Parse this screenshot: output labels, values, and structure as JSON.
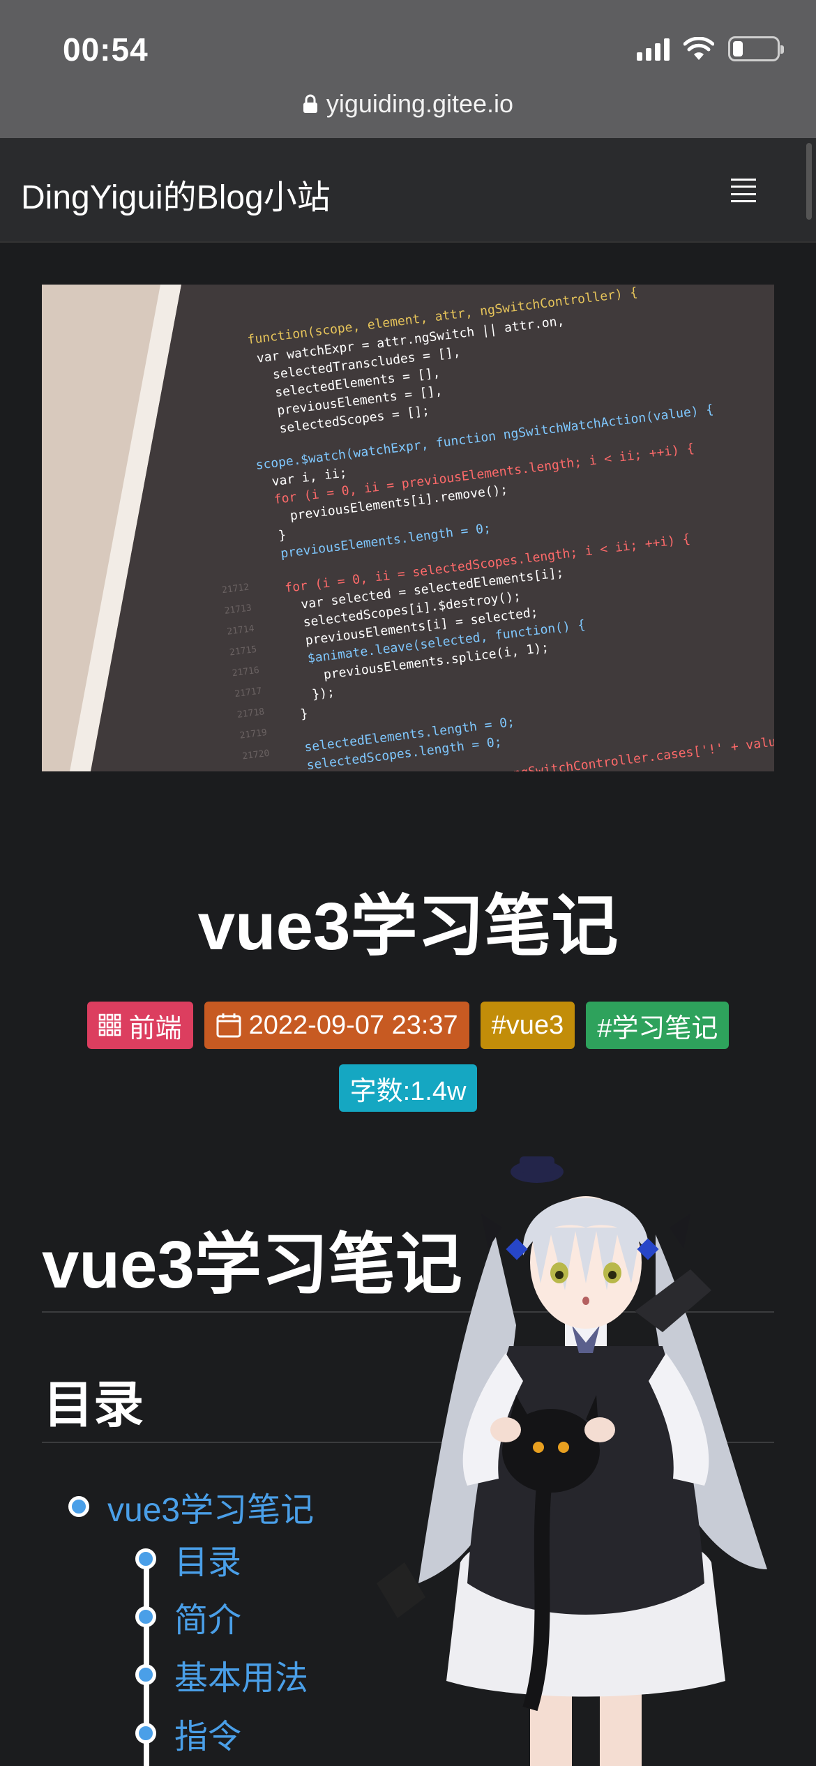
{
  "status_bar": {
    "time": "00:54",
    "url": "yiguiding.gitee.io"
  },
  "navbar": {
    "brand": "DingYigui的Blog小站"
  },
  "post": {
    "title": "vue3学习笔记",
    "badges": {
      "category": "前端",
      "date": "2022-09-07 23:37",
      "tag1": "#vue3",
      "tag2": "#学习笔记",
      "words": "字数:1.4w"
    }
  },
  "article": {
    "h1": "vue3学习笔记",
    "h2": "目录",
    "toc": [
      {
        "label": "vue3学习笔记"
      },
      {
        "label": "目录"
      },
      {
        "label": "简介"
      },
      {
        "label": "基本用法"
      },
      {
        "label": "指令"
      }
    ]
  },
  "colors": {
    "accent_link": "#4a9fe8",
    "badge_category": "#dc3e5f",
    "badge_date": "#c75a22",
    "badge_tag_vue3": "#c28d09",
    "badge_tag_notes": "#2ea25c",
    "badge_words": "#15a7c2"
  }
}
